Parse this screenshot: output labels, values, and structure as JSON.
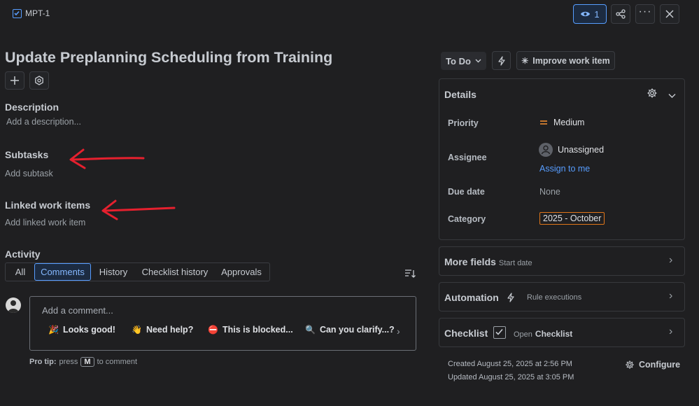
{
  "breadcrumb": {
    "key": "MPT-1"
  },
  "topbar": {
    "watch_count": "1"
  },
  "title": "Update Preplanning Scheduling from Training",
  "description": {
    "heading": "Description",
    "placeholder": "Add a description..."
  },
  "subtasks": {
    "heading": "Subtasks",
    "add": "Add subtask"
  },
  "linked": {
    "heading": "Linked work items",
    "add": "Add linked work item"
  },
  "activity": {
    "heading": "Activity",
    "tabs": [
      "All",
      "Comments",
      "History",
      "Checklist history",
      "Approvals"
    ],
    "comment_placeholder": "Add a comment...",
    "quick_replies": [
      {
        "emoji": "🎉",
        "label": "Looks good!"
      },
      {
        "emoji": "👋",
        "label": "Need help?"
      },
      {
        "emoji": "⛔",
        "label": "This is blocked..."
      },
      {
        "emoji": "🔍",
        "label": "Can you clarify...?"
      }
    ],
    "tip_bold": "Pro tip:",
    "tip_pre": "press",
    "tip_key": "M",
    "tip_post": "to comment"
  },
  "status": {
    "label": "To Do",
    "improve": "Improve work item"
  },
  "details": {
    "heading": "Details",
    "priority_label": "Priority",
    "priority_value": "Medium",
    "assignee_label": "Assignee",
    "assignee_value": "Unassigned",
    "assign_to_me": "Assign to me",
    "due_label": "Due date",
    "due_value": "None",
    "category_label": "Category",
    "category_value": "2025 - October"
  },
  "more_fields": {
    "heading": "More fields",
    "sub": "Start date"
  },
  "automation": {
    "heading": "Automation",
    "sub": "Rule executions"
  },
  "checklist": {
    "heading": "Checklist",
    "sub_pre": "Open",
    "sub_bold": "Checklist"
  },
  "meta": {
    "created": "Created August 25, 2025 at 2:56 PM",
    "updated": "Updated August 25, 2025 at 3:05 PM",
    "configure": "Configure"
  },
  "colors": {
    "accent": "#579dff",
    "annotation_arrow": "#e5202e",
    "priority": "#f79232",
    "category_border": "#e0761a"
  }
}
